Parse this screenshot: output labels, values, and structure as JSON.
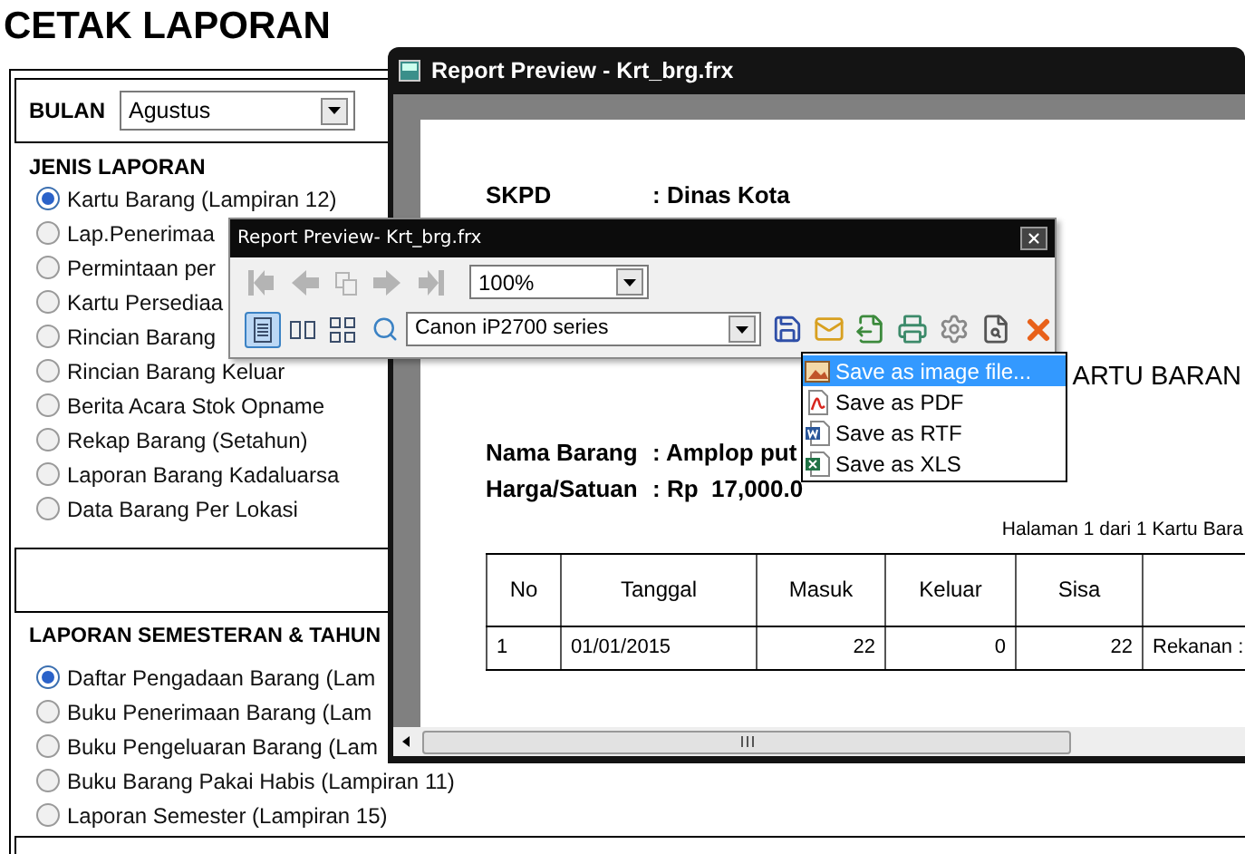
{
  "title": "CETAK LAPORAN",
  "month": {
    "label": "BULAN",
    "value": "Agustus"
  },
  "report_types": {
    "heading": "JENIS LAPORAN",
    "options": [
      {
        "label": "Kartu Barang (Lampiran 12)",
        "selected": true
      },
      {
        "label": "Lap.Penerimaa",
        "selected": false
      },
      {
        "label": "Permintaan per",
        "selected": false
      },
      {
        "label": "Kartu Persediaa",
        "selected": false
      },
      {
        "label": "Rincian Barang",
        "selected": false
      },
      {
        "label": "Rincian Barang Keluar",
        "selected": false
      },
      {
        "label": "Berita Acara Stok Opname",
        "selected": false
      },
      {
        "label": "Rekap Barang (Setahun)",
        "selected": false
      },
      {
        "label": "Laporan Barang Kadaluarsa",
        "selected": false
      },
      {
        "label": "Data Barang Per Lokasi",
        "selected": false
      }
    ]
  },
  "semester_reports": {
    "heading": "LAPORAN SEMESTERAN & TAHUN",
    "options": [
      {
        "label": "Daftar Pengadaan Barang (Lam",
        "selected": true
      },
      {
        "label": "Buku Penerimaan Barang (Lam",
        "selected": false
      },
      {
        "label": "Buku Pengeluaran Barang (Lam",
        "selected": false
      },
      {
        "label": "Buku Barang Pakai Habis (Lampiran 11)",
        "selected": false
      },
      {
        "label": "Laporan Semester (Lampiran 15)",
        "selected": false
      }
    ]
  },
  "preview_window": {
    "title": "Report Preview - Krt_brg.frx",
    "page": {
      "skpd": {
        "label": "SKPD",
        "value": ": Dinas Kota"
      },
      "heading": "ARTU BARAN",
      "fields": [
        {
          "label": "Nama Barang",
          "value": ": Amplop put"
        },
        {
          "label": "Harga/Satuan",
          "value": ": Rp  17,000.0"
        }
      ],
      "page_info": "Halaman 1 dari 1 Kartu Bara",
      "table": {
        "columns": [
          "No",
          "Tanggal",
          "Masuk",
          "Keluar",
          "Sisa"
        ],
        "rows": [
          [
            "1",
            "01/01/2015",
            "22",
            "0",
            "22",
            "Rekanan :"
          ]
        ]
      }
    }
  },
  "toolbar_window": {
    "title": "Report Preview- Krt_brg.frx",
    "navigation_disabled": true,
    "zoom": "100%",
    "printer": "Canon iP2700 series",
    "view_modes": [
      {
        "kind": "single",
        "selected": true
      },
      {
        "kind": "double",
        "selected": false
      },
      {
        "kind": "grid",
        "selected": false
      }
    ]
  },
  "export_menu": {
    "items": [
      {
        "kind": "image",
        "label": "Save as image file...",
        "selected": true
      },
      {
        "kind": "pdf",
        "label": "Save as PDF",
        "selected": false
      },
      {
        "kind": "rtf",
        "label": "Save as RTF",
        "selected": false
      },
      {
        "kind": "xls",
        "label": "Save as XLS",
        "selected": false
      }
    ]
  }
}
